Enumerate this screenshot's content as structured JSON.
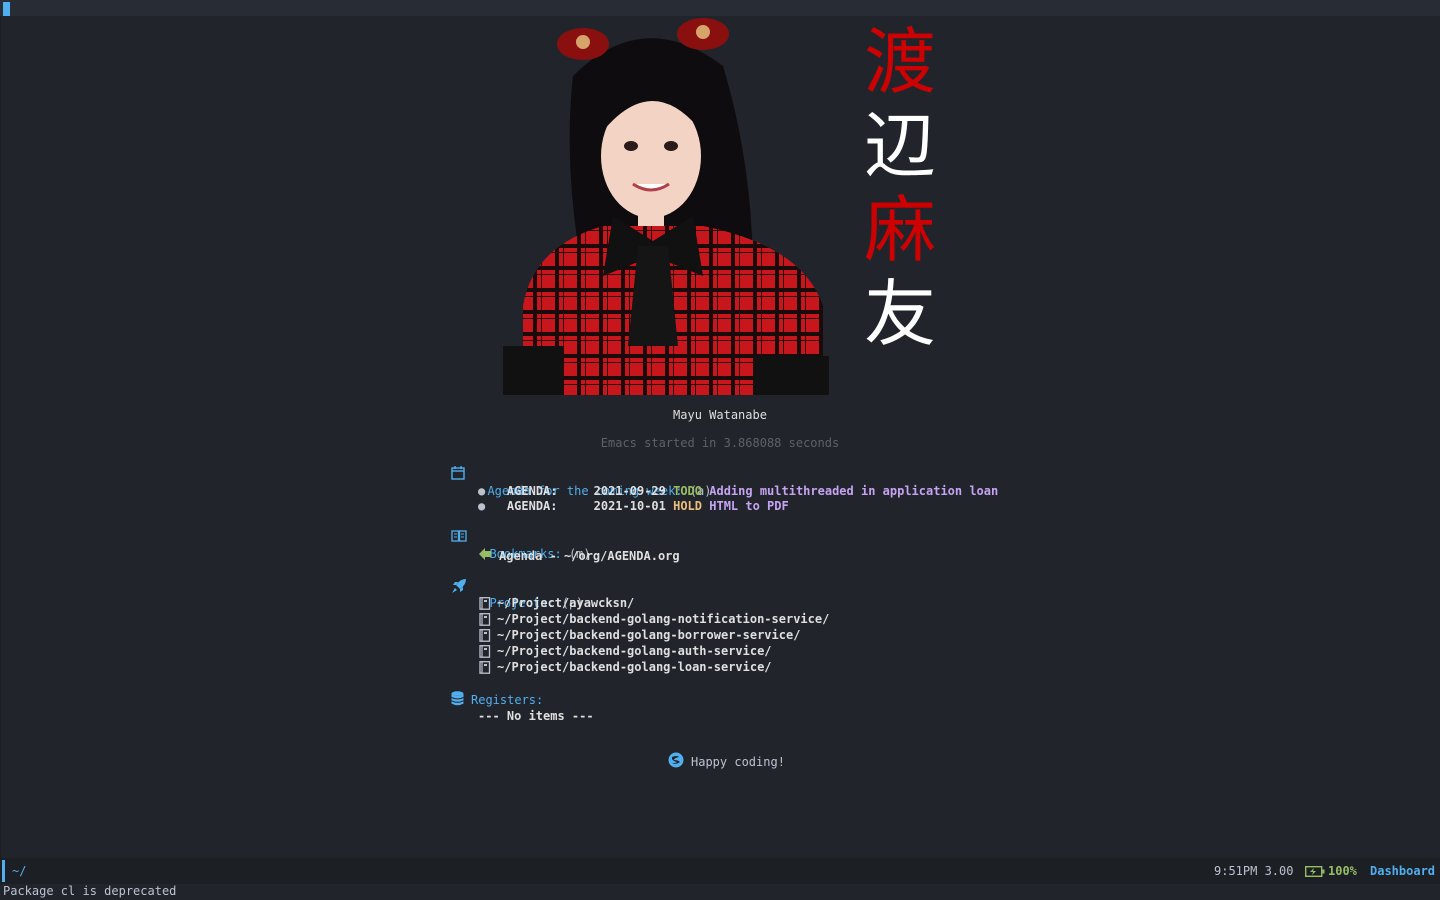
{
  "header": {
    "cursor": ""
  },
  "banner": {
    "kanji": [
      "渡",
      "辺",
      "麻",
      "友"
    ],
    "caption": "Mayu Watanabe",
    "startup": "Emacs started in 3.868088 seconds"
  },
  "agenda": {
    "heading": "Agenda for the coming week:",
    "key": "(a)",
    "items": [
      {
        "bullet": "●",
        "label": "AGENDA:",
        "date": "2021-09-29",
        "state": "TODO",
        "text": "Adding multithreaded in application loan"
      },
      {
        "bullet": "●",
        "label": "AGENDA:",
        "date": "2021-10-01",
        "state": "HOLD",
        "text": "HTML to PDF"
      }
    ]
  },
  "bookmarks": {
    "heading": "Bookmarks:",
    "key": "(m)",
    "items": [
      {
        "text": "Agenda - ~/org/AGENDA.org"
      }
    ]
  },
  "projects": {
    "heading": "Projects:",
    "key": "(p)",
    "items": [
      "~/Project/ayawcksn/",
      "~/Project/backend-golang-notification-service/",
      "~/Project/backend-golang-borrower-service/",
      "~/Project/backend-golang-auth-service/",
      "~/Project/backend-golang-loan-service/"
    ]
  },
  "registers": {
    "heading": "Registers:",
    "empty": "--- No items ---"
  },
  "footer": {
    "text": "Happy coding!"
  },
  "modeline": {
    "path": "~/",
    "time_load": "9:51PM 3.00",
    "battery": "100%",
    "mode": "Dashboard"
  },
  "echo": {
    "message": "Package cl is deprecated"
  },
  "colors": {
    "background": "#21242b",
    "accent_blue": "#51afef",
    "todo_green": "#98be65",
    "hold_yellow": "#ecbe7b",
    "task_purple": "#c5a3f2",
    "kanji_red": "#cc0000"
  }
}
